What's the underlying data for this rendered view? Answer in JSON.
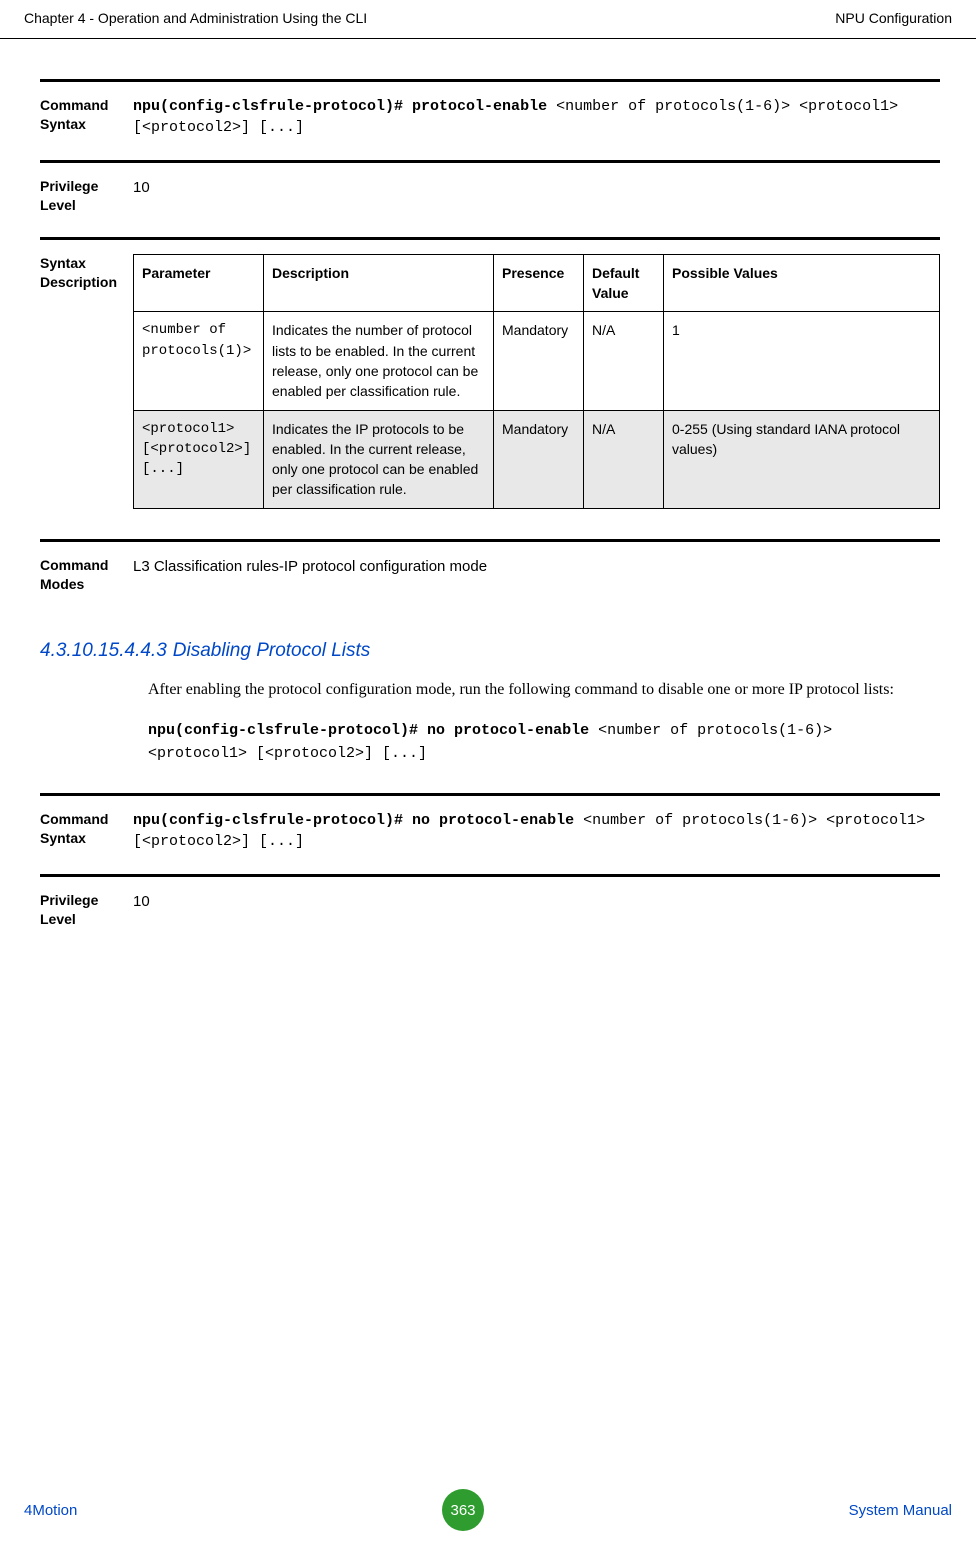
{
  "header": {
    "left": "Chapter 4 - Operation and Administration Using the CLI",
    "right": "NPU Configuration"
  },
  "section1": {
    "cmd_syntax_label": "Command Syntax",
    "cmd_syntax_bold": "npu(config-clsfrule-protocol)# protocol-enable ",
    "cmd_syntax_rest": "<number of protocols(1-6)> <protocol1> [<protocol2>] [...]",
    "priv_label": "Privilege Level",
    "priv_value": "10",
    "sd_label": "Syntax Description",
    "table": {
      "head": {
        "p": "Parameter",
        "d": "Description",
        "pr": "Presence",
        "dv": "Default Value",
        "pv": "Possible Values"
      },
      "rows": [
        {
          "param": "<number of protocols(1)>",
          "desc": "Indicates the number of protocol lists to be enabled. In the current release, only one protocol can be enabled per classification rule.",
          "presence": "Mandatory",
          "default": "N/A",
          "possible": "1",
          "shade": false
        },
        {
          "param": "<protocol1> [<protocol2>] [...]",
          "desc": "Indicates the IP protocols to be enabled. In the current release, only one protocol can be enabled per classification rule.",
          "presence": "Mandatory",
          "default": "N/A",
          "possible": "0-255 (Using standard IANA protocol values)",
          "shade": true
        }
      ]
    },
    "cmd_modes_label": "Command Modes",
    "cmd_modes_value": "L3 Classification rules-IP protocol configuration mode"
  },
  "subheading": {
    "num": "4.3.10.15.4.4.3",
    "title": "Disabling Protocol Lists"
  },
  "body_para": "After enabling the protocol configuration mode, run the following command to disable one or more IP protocol lists:",
  "body_code_bold": "npu(config-clsfrule-protocol)# no protocol-enable ",
  "body_code_rest": "<number of protocols(1-6)> <protocol1> [<protocol2>] [...]",
  "section2": {
    "cmd_syntax_label": "Command Syntax",
    "cmd_syntax_bold": "npu(config-clsfrule-protocol)# no protocol-enable ",
    "cmd_syntax_rest": "<number of protocols(1-6)> <protocol1> [<protocol2>] [...]",
    "priv_label": "Privilege Level",
    "priv_value": "10"
  },
  "footer": {
    "left": "4Motion",
    "page": "363",
    "right": "System Manual"
  }
}
